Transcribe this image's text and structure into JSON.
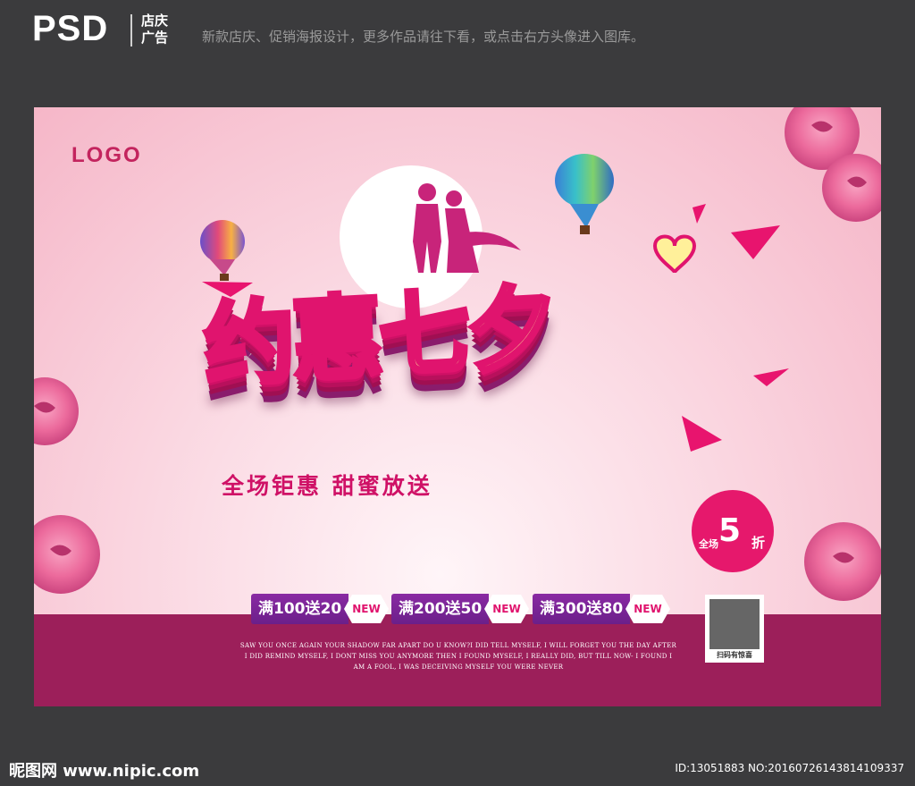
{
  "header": {
    "brand": "PSD",
    "category": "店庆 广告",
    "description": "新款店庆、促销海报设计，更多作品请往下看，或点击右方头像进入图库。"
  },
  "poster": {
    "logo": "LOGO",
    "title": "约惠七夕",
    "slogan": "全场钜惠  甜蜜放送",
    "discount": {
      "prefix": "全场",
      "number": "5",
      "suffix": "折"
    },
    "offers": [
      {
        "label": "满100送20",
        "badge": "NEW"
      },
      {
        "label": "满200送50",
        "badge": "NEW"
      },
      {
        "label": "满300送80",
        "badge": "NEW"
      }
    ],
    "small_text": "SAW YOU ONCE AGAIN YOUR SHADOW FAR APART DO U KNOW?I DID TELL MYSELF, I WILL FORGET YOU THE DAY AFTER I DID REMIND MYSELF, I DONT MISS YOU ANYMORE THEN I FOUND MYSELF, I REALLY DID, BUT TILL NOW- I FOUND I AM A FOOL, I WAS DECEIVING MYSELF YOU WERE NEVER",
    "qr_caption": "扫码有惊喜",
    "colors": {
      "background": "#fbdce5",
      "band": "#9c1f5a",
      "accent": "#e0146e",
      "title_fill": "#fff09a"
    }
  },
  "footer": {
    "site": "昵图网 www.nipic.com",
    "id": "ID:13051883 NO:20160726143814109337"
  }
}
